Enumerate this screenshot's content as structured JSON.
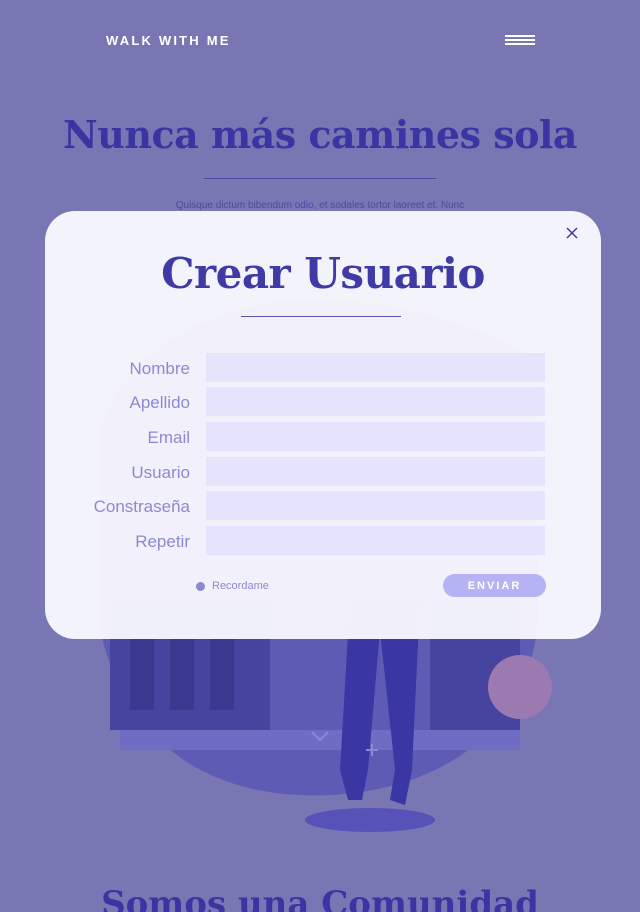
{
  "header": {
    "brand": "WALK WITH ME",
    "menu_icon": "hamburger-menu-icon"
  },
  "hero": {
    "title": "Nunca más camines sola",
    "text": "Quisque dictum bibendum odio, et sodales tortor laoreet et. Nunc"
  },
  "section2": {
    "title": "Somos una Comunidad"
  },
  "modal": {
    "title": "Crear Usuario",
    "close_icon": "close-icon",
    "fields": [
      {
        "label": "Nombre",
        "value": ""
      },
      {
        "label": "Apellido",
        "value": ""
      },
      {
        "label": "Email",
        "value": ""
      },
      {
        "label": "Usuario",
        "value": ""
      },
      {
        "label": "Constraseña",
        "value": ""
      },
      {
        "label": "Repetir",
        "value": ""
      }
    ],
    "remember_label": "Recordame",
    "submit_label": "ENVIAR"
  },
  "colors": {
    "background": "#7876b3",
    "accent": "#3f3aa6",
    "label": "#8c89d4",
    "input": "#e6e4fd",
    "button": "#b6b3f5"
  }
}
